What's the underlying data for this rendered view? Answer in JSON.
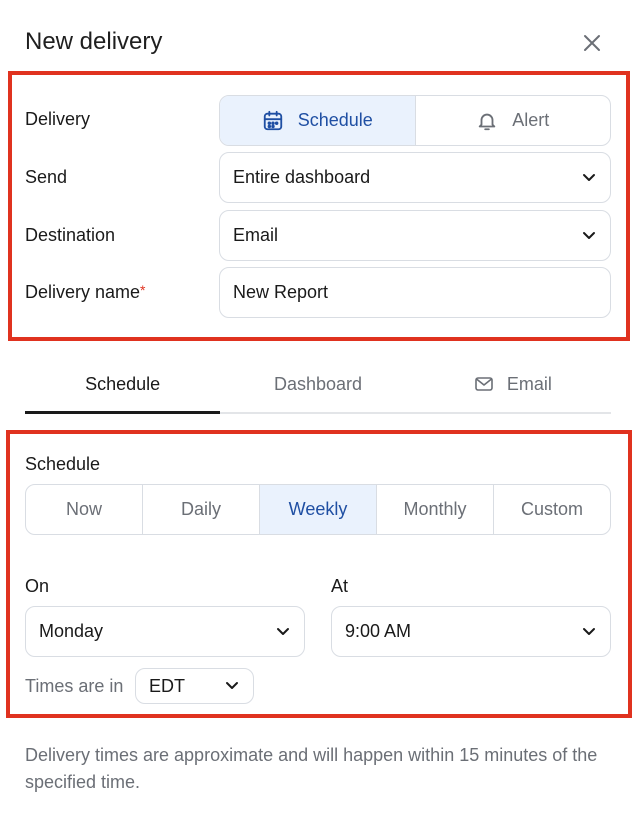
{
  "header": {
    "title": "New delivery"
  },
  "form": {
    "delivery_label": "Delivery",
    "delivery_options": [
      {
        "label": "Schedule",
        "icon": "calendar-icon",
        "selected": true
      },
      {
        "label": "Alert",
        "icon": "bell-icon",
        "selected": false
      }
    ],
    "send_label": "Send",
    "send_value": "Entire dashboard",
    "destination_label": "Destination",
    "destination_value": "Email",
    "name_label": "Delivery name",
    "name_required_mark": "*",
    "name_value": "New Report"
  },
  "tabs": [
    {
      "label": "Schedule",
      "active": true
    },
    {
      "label": "Dashboard",
      "active": false
    },
    {
      "label": "Email",
      "icon": "mail-icon",
      "active": false
    }
  ],
  "schedule": {
    "heading": "Schedule",
    "frequency_options": [
      {
        "label": "Now",
        "selected": false
      },
      {
        "label": "Daily",
        "selected": false
      },
      {
        "label": "Weekly",
        "selected": true
      },
      {
        "label": "Monthly",
        "selected": false
      },
      {
        "label": "Custom",
        "selected": false
      }
    ],
    "on_label": "On",
    "on_value": "Monday",
    "at_label": "At",
    "at_value": "9:00 AM",
    "timezone_prefix": "Times are in",
    "timezone_value": "EDT"
  },
  "note": "Delivery times are approximate and will happen within 15 minutes of the specified time.",
  "colors": {
    "accent": "#1f4fa3",
    "accent_bg": "#eaf2fd",
    "highlight": "#e0321f",
    "border": "#d9dde3",
    "muted": "#6b6f76"
  }
}
